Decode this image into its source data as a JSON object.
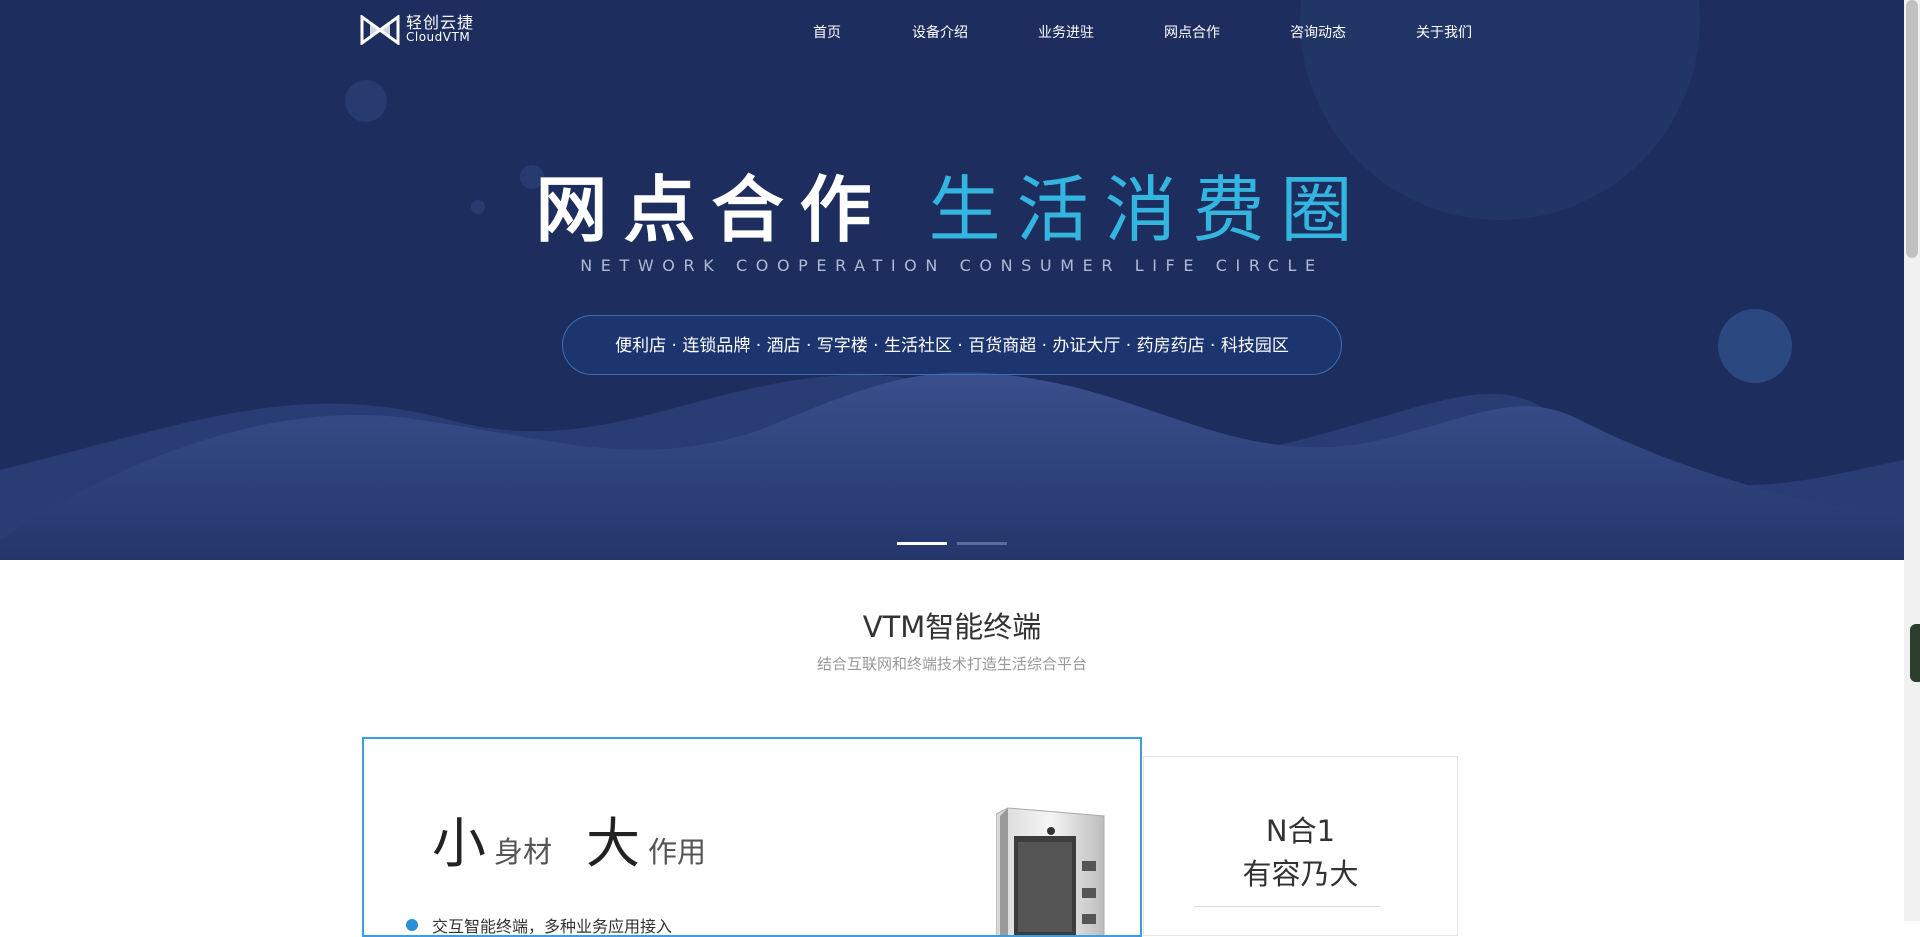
{
  "logo": {
    "cn": "轻创云捷",
    "en": "CloudVTM"
  },
  "nav": {
    "items": [
      "首页",
      "设备介绍",
      "业务进驻",
      "网点合作",
      "咨询动态",
      "关于我们"
    ]
  },
  "hero": {
    "title_white": "网点合作",
    "title_blue": "生活消费圈",
    "subtitle": "NETWORK COOPERATION CONSUMER LIFE CIRCLE",
    "scenes": "便利店 · 连锁品牌 · 酒店 · 写字楼 · 生活社区 · 百货商超 · 办证大厅 · 药房药店 · 科技园区",
    "slides_total": 2,
    "slide_active": 1
  },
  "section": {
    "title": "VTM智能终端",
    "subtitle": "结合互联网和终端技术打造生活综合平台"
  },
  "card_main": {
    "big1": "小",
    "small1": "身材",
    "big2": "大",
    "small2": "作用",
    "bullet": "交互智能终端，多种业务应用接入"
  },
  "card_side": {
    "line1": "N合1",
    "line2": "有容乃大"
  },
  "colors": {
    "hero_bg": "#1d2d5e",
    "accent_blue": "#33b5e0",
    "card_border": "#3a9fe0"
  }
}
